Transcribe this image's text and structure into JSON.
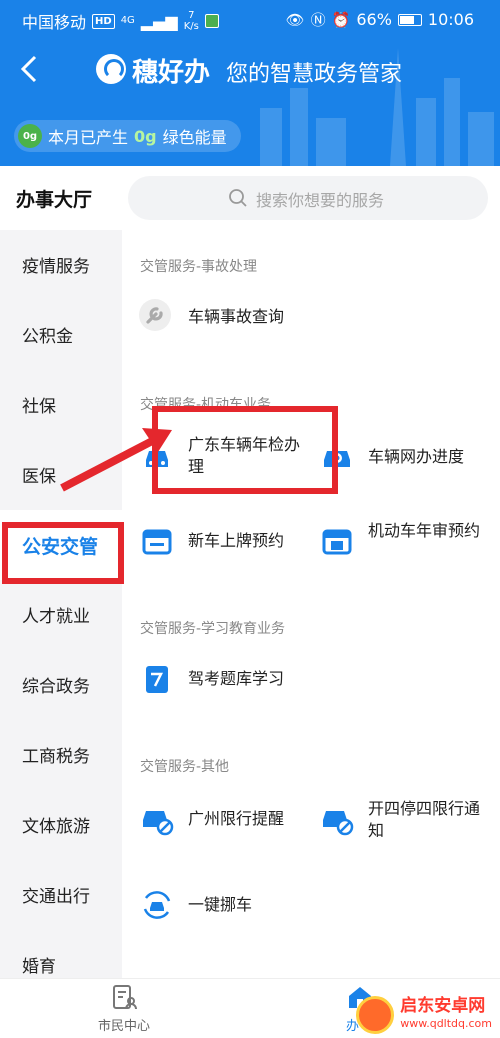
{
  "status_bar": {
    "carrier": "中国移动",
    "hd": "HD",
    "network": "4G",
    "speed_value": "7",
    "speed_unit": "K/s",
    "battery": "66%",
    "time": "10:06"
  },
  "header": {
    "back_icon": "chevron-left-icon",
    "brand": "穗好办",
    "slogan": "您的智慧政务管家",
    "energy_prefix": "本月已产生",
    "energy_value": "0g",
    "energy_suffix": "绿色能量",
    "energy_badge": "0g",
    "colors": {
      "primary": "#1a82e8"
    }
  },
  "hall": {
    "title": "办事大厅",
    "search_placeholder": "搜索你想要的服务"
  },
  "sidebar": {
    "active_index": 4,
    "items": [
      {
        "label": "疫情服务"
      },
      {
        "label": "公积金"
      },
      {
        "label": "社保"
      },
      {
        "label": "医保"
      },
      {
        "label": "公安交管"
      },
      {
        "label": "人才就业"
      },
      {
        "label": "综合政务"
      },
      {
        "label": "工商税务"
      },
      {
        "label": "文体旅游"
      },
      {
        "label": "交通出行"
      },
      {
        "label": "婚育"
      }
    ]
  },
  "sections": [
    {
      "title": "交管服务-事故处理",
      "services": [
        {
          "label": "车辆事故查询",
          "icon": "wrench-icon"
        }
      ]
    },
    {
      "title": "交管服务-机动车业务",
      "services": [
        {
          "label": "广东车辆年检办理",
          "icon": "car-icon"
        },
        {
          "label": "车辆网办进度",
          "icon": "car-progress-icon"
        },
        {
          "label": "新车上牌预约",
          "icon": "calendar-icon"
        },
        {
          "label": "机动车年审预约",
          "icon": "calendar-review-icon"
        }
      ]
    },
    {
      "title": "交管服务-学习教育业务",
      "services": [
        {
          "label": "驾考题库学习",
          "icon": "document-icon"
        }
      ]
    },
    {
      "title": "交管服务-其他",
      "services": [
        {
          "label": "广州限行提醒",
          "icon": "car-restrict-icon"
        },
        {
          "label": "开四停四限行通知",
          "icon": "car-restrict-icon"
        },
        {
          "label": "一键挪车",
          "icon": "car-move-icon"
        }
      ]
    }
  ],
  "bottom_nav": {
    "items": [
      {
        "label": "市民中心",
        "icon": "citizen-center-icon"
      },
      {
        "label": "办",
        "icon": "office-hall-icon"
      }
    ]
  },
  "watermark": {
    "title": "启东安卓网",
    "url": "www.qdltdq.com"
  }
}
